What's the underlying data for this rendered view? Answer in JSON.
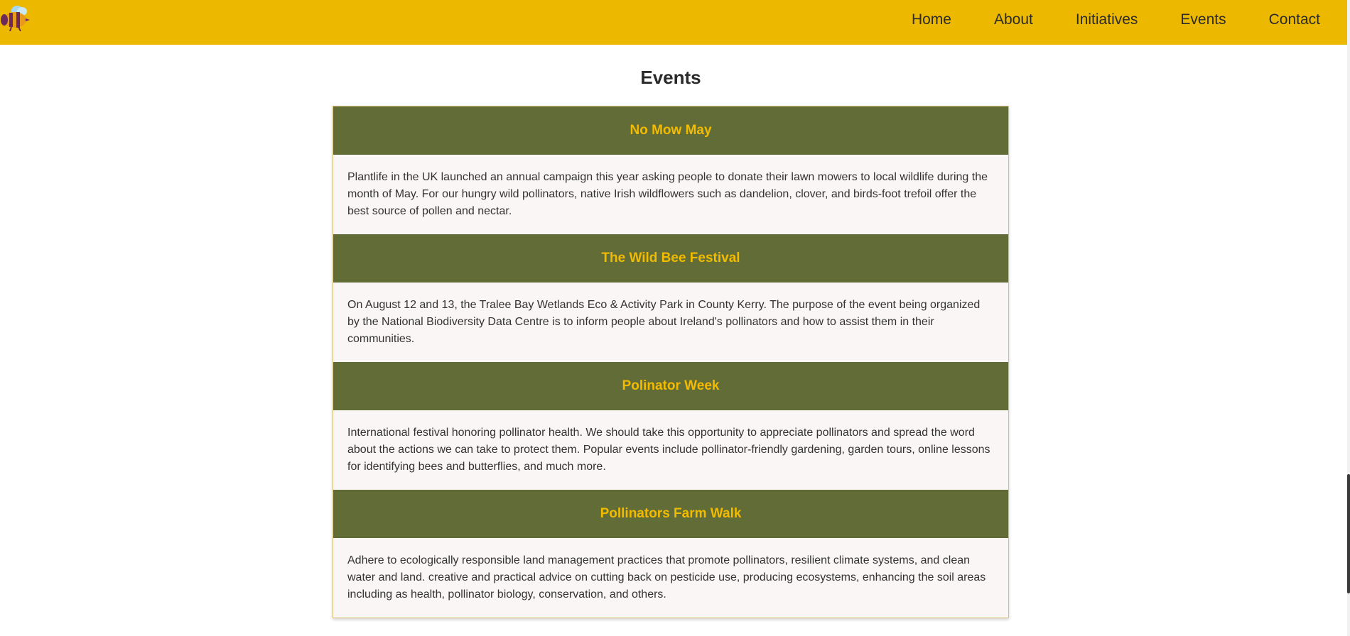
{
  "nav": {
    "logo_icon": "bee-icon",
    "links": [
      "Home",
      "About",
      "Initiatives",
      "Events",
      "Contact"
    ]
  },
  "colors": {
    "nav_bg": "#edb900",
    "event_header_bg": "#616c37",
    "event_title": "#f2bb00",
    "event_body_bg": "#faf6f5"
  },
  "main": {
    "title": "Events",
    "events": [
      {
        "title": "No Mow May",
        "description": "Plantlife in the UK launched an annual campaign this year asking people to donate their lawn mowers to local wildlife during the month of May. For our hungry wild pollinators, native Irish wildflowers such as dandelion, clover, and birds-foot trefoil offer the best source of pollen and nectar."
      },
      {
        "title": "The Wild Bee Festival",
        "description": "On August 12 and 13, the Tralee Bay Wetlands Eco & Activity Park in County Kerry. The purpose of the event being organized by the National Biodiversity Data Centre is to inform people about Ireland's pollinators and how to assist them in their communities."
      },
      {
        "title": "Polinator Week",
        "description": "International festival honoring pollinator health. We should take this opportunity to appreciate pollinators and spread the word about the actions we can take to protect them. Popular events include pollinator-friendly gardening, garden tours, online lessons for identifying bees and butterflies, and much more."
      },
      {
        "title": "Pollinators Farm Walk",
        "description": "Adhere to ecologically responsible land management practices that promote pollinators, resilient climate systems, and clean water and land. creative and practical advice on cutting back on pesticide use, producing ecosystems, enhancing the soil areas including as health, pollinator biology, conservation, and others."
      }
    ]
  }
}
